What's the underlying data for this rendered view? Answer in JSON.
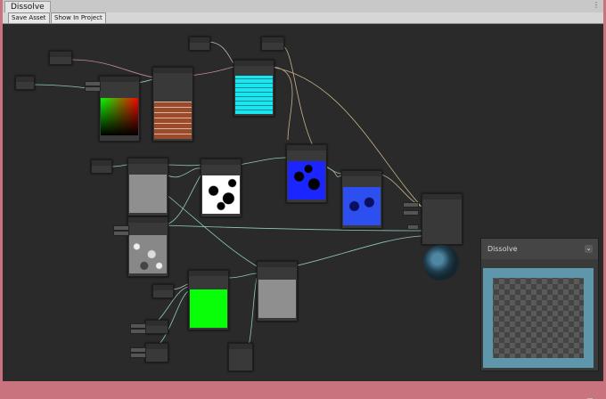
{
  "window": {
    "title": "Dissolve",
    "menu_icon": "⋮"
  },
  "toolbar": {
    "save_label": "Save Asset",
    "show_label": "Show In Project"
  },
  "preview": {
    "title": "Dissolve",
    "chevron_icon": "chevron-down-icon",
    "chevron_glyph": "⌄"
  },
  "colors": {
    "window_border": "#c9737f",
    "canvas_bg": "#2a2a2a",
    "node_bg": "#393939",
    "wire_teal": "#8fc9c0",
    "wire_pink": "#c78a9a",
    "wire_tan": "#c9b48a"
  }
}
